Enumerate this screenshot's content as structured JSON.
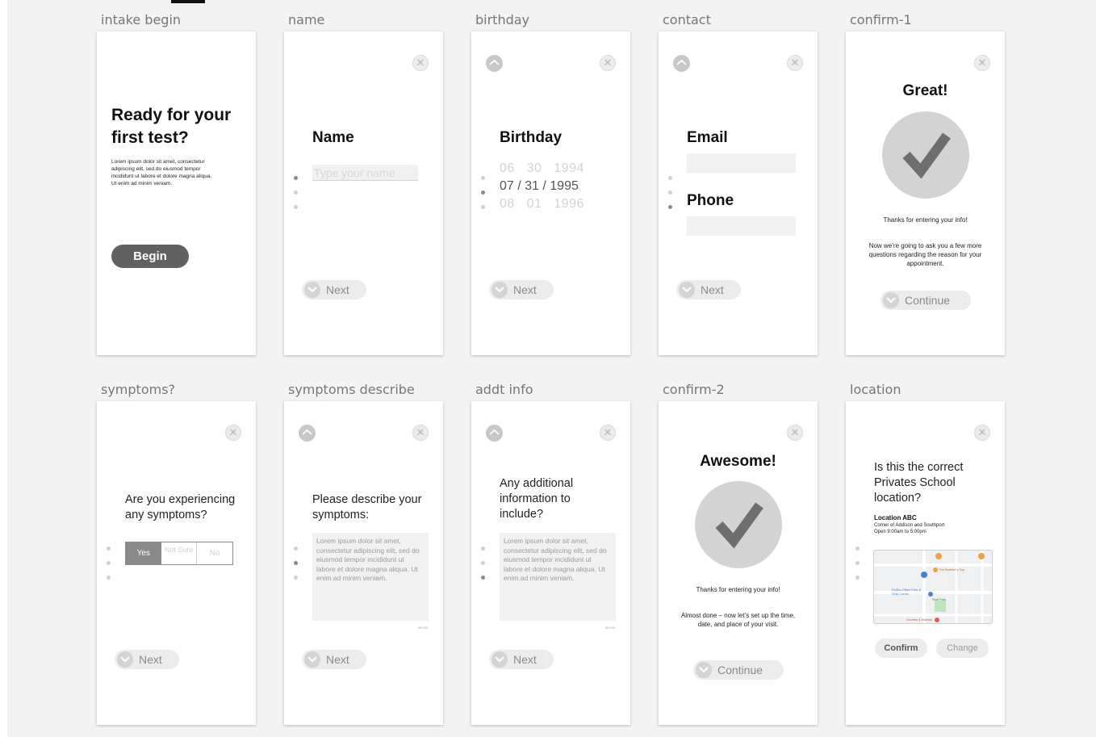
{
  "frames": [
    {
      "label": "intake begin",
      "title": "Ready for your first test?",
      "body": "Lorem ipsum dolor sit amet, consectetur adipiscing elit, sed do eiusmod tempor incididunt ut labore et dolore magna aliqua. Ut enim ad minim veniam.",
      "button": "Begin"
    },
    {
      "label": "name",
      "title": "Name",
      "placeholder": "Type your name",
      "button": "Next"
    },
    {
      "label": "birthday",
      "title": "Birthday",
      "dates": {
        "prev": [
          "06",
          "30",
          "1994"
        ],
        "current": "07 / 31 / 1995",
        "next": [
          "08",
          "01",
          "1996"
        ]
      },
      "button": "Next"
    },
    {
      "label": "contact",
      "email_label": "Email",
      "phone_label": "Phone",
      "button": "Next"
    },
    {
      "label": "confirm-1",
      "title": "Great!",
      "line1": "Thanks for entering your info!",
      "line2": "Now we’re going to ask you a few more questions regarding the reason for your appointment.",
      "button": "Continue"
    },
    {
      "label": "symptoms?",
      "question": "Are you experiencing any symptoms?",
      "options": [
        "Yes",
        "Not Sure",
        "No"
      ],
      "selected": "Yes",
      "button": "Next"
    },
    {
      "label": "symptoms describe",
      "question": "Please describe your symptoms:",
      "text": "Lorem ipsum dolor sit amet, consectetur adipiscing elit, sed do eiusmod tempor incididunt ut labore et dolore magna aliqua. Ut enim ad minim veniam.",
      "counter": "55/250",
      "button": "Next"
    },
    {
      "label": "addt info",
      "question": "Any additional information to include?",
      "text": "Lorem ipsum dolor sit amet, consectetur adipiscing elit, sed do eiusmod tempor incididunt ut labore et dolore magna aliqua. Ut enim ad minim veniam.",
      "counter": "55/250",
      "button": "Next"
    },
    {
      "label": "confirm-2",
      "title": "Awesome!",
      "line1": "Thanks for entering your info!",
      "line2": "Almost done – now let’s set up the time, date, and place of your visit.",
      "button": "Continue"
    },
    {
      "label": "location",
      "question": "Is this the correct Privates School location?",
      "loc_name": "Location ABC",
      "loc_addr": "Corner of Addison and Southport",
      "loc_hours": "Open 9:00am to 5:00pm",
      "confirm": "Confirm",
      "change": "Change",
      "map_labels": {
        "poi1": "The Butcher's Tap",
        "poi2": "FedEx Office Print & Ship Center",
        "poi3": "Shel Park",
        "poi4": "Crumbs & Kitchen"
      }
    }
  ],
  "colors": {
    "card": "#ffffff",
    "canvas": "#f3f3f3",
    "primary_btn": "#616161",
    "check": "#d3d3d3",
    "check_mark": "#6e6e6e"
  }
}
